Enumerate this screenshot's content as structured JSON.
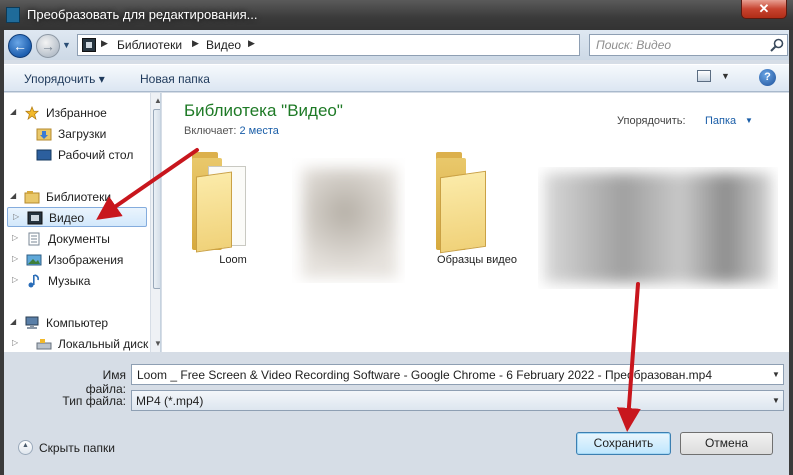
{
  "window": {
    "title": "Преобразовать для редактирования...",
    "close_label": "✕"
  },
  "nav": {
    "back_label": "←",
    "forward_label": "→",
    "breadcrumbs": [
      "Библиотеки",
      "Видео"
    ],
    "refresh_label": "↻",
    "search_placeholder": "Поиск: Видео"
  },
  "toolbar": {
    "organize_label": "Упорядочить ▾",
    "new_folder_label": "Новая папка",
    "help_label": "?"
  },
  "sidebar": {
    "items": [
      {
        "label": "Избранное",
        "icon": "star-icon"
      },
      {
        "label": "Загрузки",
        "icon": "downloads-folder-icon"
      },
      {
        "label": "Рабочий стол",
        "icon": "desktop-icon"
      },
      {
        "label": "Библиотеки",
        "icon": "libraries-icon"
      },
      {
        "label": "Видео",
        "icon": "video-library-icon",
        "selected": true
      },
      {
        "label": "Документы",
        "icon": "documents-library-icon"
      },
      {
        "label": "Изображения",
        "icon": "pictures-library-icon"
      },
      {
        "label": "Музыка",
        "icon": "music-library-icon"
      },
      {
        "label": "Компьютер",
        "icon": "computer-icon"
      },
      {
        "label": "Локальный диск",
        "icon": "local-disk-icon"
      }
    ]
  },
  "library": {
    "title": "Библиотека \"Видео\"",
    "includes_label": "Включает:",
    "includes_link": "2 места",
    "arrange_label": "Упорядочить:",
    "arrange_value": "Папка"
  },
  "files": [
    {
      "name": "Loom",
      "type": "folder"
    },
    {
      "name": "",
      "type": "blurred-thumbnail"
    },
    {
      "name": "Образцы видео",
      "type": "folder"
    },
    {
      "name": "",
      "type": "blurred-thumbnail"
    }
  ],
  "form": {
    "filename_label": "Имя файла:",
    "filename_value": "Loom _ Free Screen & Video Recording Software - Google Chrome - 6 February 2022 - Преобразован.mp4",
    "filetype_label": "Тип файла:",
    "filetype_value": "MP4 (*.mp4)"
  },
  "footer": {
    "hide_folders_label": "Скрыть папки",
    "save_label": "Сохранить",
    "cancel_label": "Отмена"
  },
  "colors": {
    "accent_green": "#1e7a26",
    "link_blue": "#1a5ea8",
    "annotation_red": "#c8161d"
  }
}
